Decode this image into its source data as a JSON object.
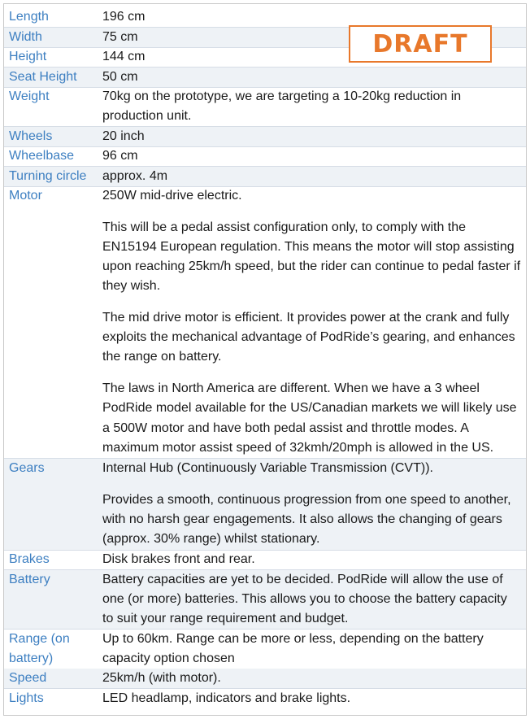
{
  "stamp": "DRAFT",
  "specs": [
    {
      "label": "Length",
      "value": [
        "196 cm"
      ]
    },
    {
      "label": "Width",
      "value": [
        "75 cm"
      ]
    },
    {
      "label": "Height",
      "value": [
        "144 cm"
      ]
    },
    {
      "label": "Seat Height",
      "value": [
        "50 cm"
      ]
    },
    {
      "label": "Weight",
      "value": [
        "70kg on the prototype, we are targeting a 10-20kg reduction in production unit."
      ]
    },
    {
      "label": "Wheels",
      "value": [
        "20 inch"
      ]
    },
    {
      "label": "Wheelbase",
      "value": [
        "96 cm"
      ]
    },
    {
      "label": "Turning circle",
      "value": [
        "approx. 4m"
      ]
    },
    {
      "label": "Motor",
      "value": [
        "250W mid-drive electric.",
        "This will be a pedal assist configuration only, to comply with the EN15194 European regulation. This means the motor will stop assisting upon reaching 25km/h speed, but the rider can continue to pedal faster if they wish.",
        "The mid drive motor is efficient. It provides power at the crank and fully exploits the mechanical advantage of PodRide’s gearing, and enhances the range on battery.",
        "The laws in North America are different. When we have a 3 wheel PodRide model available for the US/Canadian markets we will likely use a 500W motor and have both pedal assist and throttle modes. A maximum motor assist speed of 32kmh/20mph is allowed in the US."
      ]
    },
    {
      "label": "Gears",
      "value": [
        "Internal Hub (Continuously Variable Transmission (CVT)).",
        "Provides a smooth, continuous progression from one speed to another, with no harsh gear engagements. It also allows the changing of gears (approx. 30% range) whilst stationary."
      ]
    },
    {
      "label": "Brakes",
      "value": [
        "Disk brakes front and rear."
      ]
    },
    {
      "label": "Battery",
      "value": [
        "Battery capacities are yet to be decided. PodRide will allow the use of one (or more) batteries. This allows you to choose the battery capacity to suit your range requirement and budget."
      ]
    },
    {
      "label": "Range (on battery)",
      "value": [
        "Up to 60km. Range can be more or less, depending on the battery capacity option chosen"
      ]
    },
    {
      "label": "Speed",
      "value": [
        "25km/h (with motor)."
      ]
    },
    {
      "label": "Lights",
      "value": [
        "LED headlamp, indicators and brake lights."
      ]
    }
  ]
}
